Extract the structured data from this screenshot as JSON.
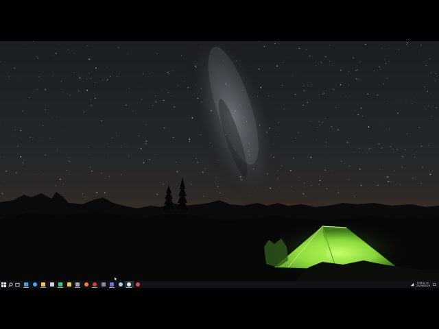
{
  "desktop": {
    "wallpaper": "night sky with milky way over mountain silhouettes and a glowing green tent",
    "colors": {
      "sky_top": "#1b1e22",
      "horizon_glow": "#ff6a1e",
      "tent": "#9ee84a",
      "taskbar": "#101216"
    }
  },
  "taskbar": {
    "start_icon": "windows-logo-icon",
    "search_icon": "search-icon",
    "task_view_icon": "task-view-icon",
    "apps": [
      {
        "name": "edge",
        "color": "#3aa0e8"
      },
      {
        "name": "chrome",
        "color": "#4aa3ff"
      },
      {
        "name": "file-explorer",
        "color": "#f3c24b"
      },
      {
        "name": "store",
        "color": "#cfd6de"
      },
      {
        "name": "spreadsheet",
        "color": "#2ecc71"
      },
      {
        "name": "chrome-alt",
        "color": "#f2c744"
      },
      {
        "name": "app-gray",
        "color": "#9aa3ad"
      },
      {
        "name": "firefox",
        "color": "#ff7a2e"
      },
      {
        "name": "media-player",
        "color": "#e03b3b"
      },
      {
        "name": "settings",
        "color": "#7f8fa6"
      },
      {
        "name": "teams",
        "color": "#6a75e0"
      },
      {
        "name": "photos",
        "color": "#9ad0ff"
      },
      {
        "name": "camera",
        "color": "#e8e8e8"
      },
      {
        "name": "recorder",
        "color": "#e34848"
      }
    ],
    "clock_time": "5:08 p. m.",
    "clock_date": "22/09/2020"
  }
}
